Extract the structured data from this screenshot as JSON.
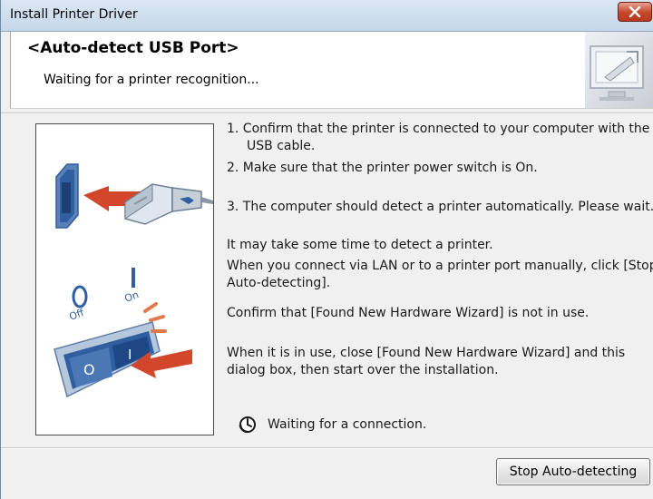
{
  "window": {
    "title": "Install Printer Driver"
  },
  "header": {
    "title": "<Auto-detect USB Port>",
    "subtitle": "Waiting for a printer recognition..."
  },
  "instructions": {
    "step1_line1": "1. Confirm that the printer is connected to your computer with the",
    "step1_line2": "USB cable.",
    "step2": "2. Make sure that the printer power switch is On.",
    "step3": "3. The computer should detect a printer automatically. Please wait.",
    "note1": "It may take some time to detect a printer.",
    "note2_line1": "When you connect via LAN or to a printer port manually, click [Stop",
    "note2_line2": "Auto-detecting].",
    "note3": "Confirm that [Found New Hardware Wizard] is not in use.",
    "note4_line1": "When it is in use, close [Found New Hardware Wizard] and this",
    "note4_line2": "dialog box, then start over the installation."
  },
  "status": {
    "text": "Waiting for a connection."
  },
  "illustration": {
    "switch_off_label": "Off",
    "switch_on_label": "On",
    "switch_left_symbol": "O",
    "switch_right_symbol": "I",
    "accent_color": "#d2472c",
    "usb_color": "#2f5fa0"
  },
  "buttons": {
    "stop_label": "Stop Auto-detecting"
  },
  "icons": {
    "close": "close-icon",
    "clock": "clock-icon",
    "header_graphic": "computer-screen-icon"
  }
}
